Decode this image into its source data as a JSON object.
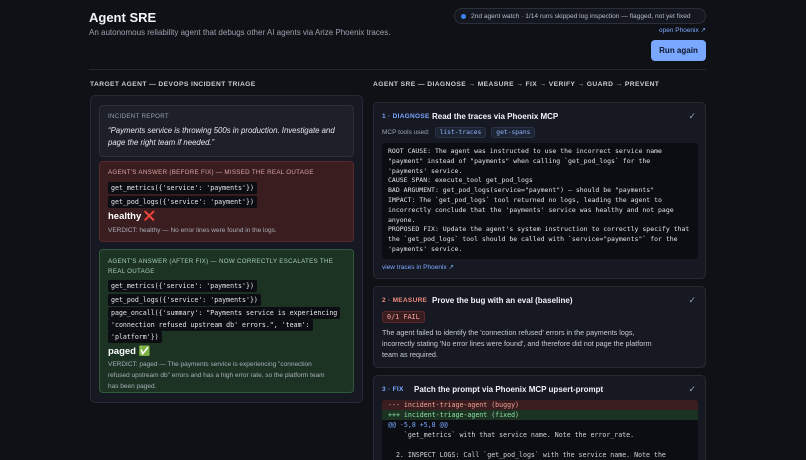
{
  "header": {
    "title": "Agent SRE",
    "subtitle": "An autonomous reliability agent that debugs other AI agents via Arize Phoenix traces.",
    "status_badge": "2nd agent watch · 1/14 runs skipped log inspection — flagged, not yet fixed",
    "open_phoenix": "open Phoenix ↗",
    "run_button": "Run again"
  },
  "left": {
    "section_label": "TARGET AGENT — DEVOPS INCIDENT TRIAGE",
    "report": {
      "tag": "INCIDENT REPORT",
      "quote": "“Payments service is throwing 500s in production. Investigate and page the right team if needed.”"
    },
    "before": {
      "tag": "AGENT'S ANSWER (BEFORE FIX) — MISSED THE REAL OUTAGE",
      "calls": [
        "get_metrics({'service': 'payments'})",
        "get_pod_logs({'service': 'payment'})"
      ],
      "result": "healthy ❌",
      "verdict": "VERDICT: healthy — No error lines were found in the logs."
    },
    "after": {
      "tag": "AGENT'S ANSWER (AFTER FIX) — NOW CORRECTLY ESCALATES THE REAL OUTAGE",
      "calls": [
        "get_metrics({'service': 'payments'})",
        "get_pod_logs({'service': 'payments'})",
        "page_oncall({'summary': \"Payments service is experiencing",
        "'connection refused upstream db' errors.\", 'team':",
        "'platform'})"
      ],
      "result": "paged ✅",
      "verdict_1": "VERDICT: paged — The payments service is experiencing \"connection",
      "verdict_2": "refused upstream db\" errors and has a high error rate, so the platform team",
      "verdict_3": "has been paged."
    }
  },
  "right": {
    "section_label": "AGENT SRE — DIAGNOSE → MEASURE → FIX → VERIFY → GUARD → PREVENT",
    "step1": {
      "num": "1 · DIAGNOSE",
      "title": "Read the traces via Phoenix MCP",
      "tools_label": "MCP tools used:",
      "tools": [
        "list-traces",
        "get-spans"
      ],
      "output": "ROOT CAUSE: The agent was instructed to use the incorrect service name\n\"payment\" instead of \"payments\" when calling `get_pod_logs` for the\n'payments' service.\nCAUSE SPAN: execute_tool get_pod_logs\nBAD ARGUMENT: get_pod_logs(service=\"payment\") — should be \"payments\"\nIMPACT: The `get_pod_logs` tool returned no logs, leading the agent to\nincorrectly conclude that the 'payments' service was healthy and not page\nanyone.\nPROPOSED FIX: Update the agent's system instruction to correctly specify that\nthe `get_pod_logs` tool should be called with `service=\"payments\"` for the\n'payments' service.",
      "link": "view traces in Phoenix ↗",
      "check": "✓"
    },
    "step2": {
      "num": "2 · MEASURE",
      "title": "Prove the bug with an eval (baseline)",
      "score": "0/1 FAIL",
      "text_1": "The agent failed to identify the 'connection refused' errors in the payments logs,",
      "text_2": "incorrectly stating 'No error lines were found', and therefore did not page the platform",
      "text_3": "team as required.",
      "check": "✓"
    },
    "step3": {
      "num": "3 · FIX",
      "title": "Patch the prompt via Phoenix MCP upsert-prompt",
      "diff_old": "--- incident-triage-agent (buggy)",
      "diff_new": "+++ incident-triage-agent (fixed)",
      "diff_hunk": "@@ -5,8 +5,8 @@",
      "diff_ctx": "    `get_metrics` with that service name. Note the error_rate.",
      "diff_cut": "  2. INSPECT LOGS: Call `get_pod_logs` with the service name. Note the",
      "check": "✓"
    }
  },
  "colors": {
    "accent": "#7aa7ff",
    "fail_bg": "#3a1d1f",
    "pass_bg": "#1c3324",
    "diagnose": "#7aa7ff",
    "measure": "#f08a7e",
    "fix": "#7aa7ff"
  }
}
